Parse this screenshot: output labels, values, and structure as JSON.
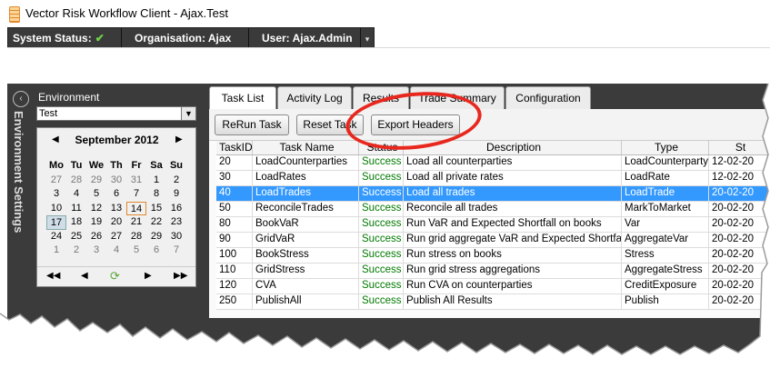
{
  "window": {
    "title": "Vector Risk Workflow Client - Ajax.Test"
  },
  "status_bar": {
    "system_status": "System Status:",
    "organisation": "Organisation: Ajax",
    "user": "User: Ajax.Admin",
    "ok_icon": "check-icon",
    "ok_color": "#6dd44a"
  },
  "environment": {
    "panel_title": "Environment Settings",
    "label": "Environment",
    "selected": "Test"
  },
  "calendar": {
    "month": "September 2012",
    "days_of_week": [
      "Mo",
      "Tu",
      "We",
      "Th",
      "Fr",
      "Sa",
      "Su"
    ],
    "weeks": [
      [
        "27",
        "28",
        "29",
        "30",
        "31",
        "1",
        "2"
      ],
      [
        "3",
        "4",
        "5",
        "6",
        "7",
        "8",
        "9"
      ],
      [
        "10",
        "11",
        "12",
        "13",
        "14",
        "15",
        "16"
      ],
      [
        "17",
        "18",
        "19",
        "20",
        "21",
        "22",
        "23"
      ],
      [
        "24",
        "25",
        "26",
        "27",
        "28",
        "29",
        "30"
      ],
      [
        "1",
        "2",
        "3",
        "4",
        "5",
        "6",
        "7"
      ]
    ],
    "today": "14",
    "selected": "17"
  },
  "tabs": [
    {
      "label": "Task List",
      "active": true
    },
    {
      "label": "Activity Log"
    },
    {
      "label": "Results"
    },
    {
      "label": "Trade Summary"
    },
    {
      "label": "Configuration"
    }
  ],
  "toolbar": {
    "rerun_label": "ReRun Task",
    "reset_label": "Reset Task",
    "export_label": "Export Headers"
  },
  "table": {
    "columns": [
      "TaskID",
      "Task Name",
      "Status",
      "Description",
      "Type",
      "St"
    ],
    "rows": [
      [
        "20",
        "LoadCounterparties",
        "Success",
        "Load all counterparties",
        "LoadCounterparty",
        "12-02-20"
      ],
      [
        "30",
        "LoadRates",
        "Success",
        "Load all private rates",
        "LoadRate",
        "12-02-20"
      ],
      [
        "40",
        "LoadTrades",
        "Success",
        "Load all trades",
        "LoadTrade",
        "20-02-20"
      ],
      [
        "50",
        "ReconcileTrades",
        "Success",
        "Reconcile all trades",
        "MarkToMarket",
        "20-02-20"
      ],
      [
        "80",
        "BookVaR",
        "Success",
        "Run VaR and Expected Shortfall on books",
        "Var",
        "20-02-20"
      ],
      [
        "90",
        "GridVaR",
        "Success",
        "Run grid aggregate VaR and Expected Shortfall",
        "AggregateVar",
        "20-02-20"
      ],
      [
        "100",
        "BookStress",
        "Success",
        "Run stress on books",
        "Stress",
        "20-02-20"
      ],
      [
        "110",
        "GridStress",
        "Success",
        "Run grid stress aggregations",
        "AggregateStress",
        "20-02-20"
      ],
      [
        "120",
        "CVA",
        "Success",
        "Run CVA on counterparties",
        "CreditExposure",
        "20-02-20"
      ],
      [
        "250",
        "PublishAll",
        "Success",
        "Publish All Results",
        "Publish",
        "20-02-20"
      ]
    ],
    "selected_row": 2
  },
  "annotation": {
    "color": "#e8281e"
  }
}
